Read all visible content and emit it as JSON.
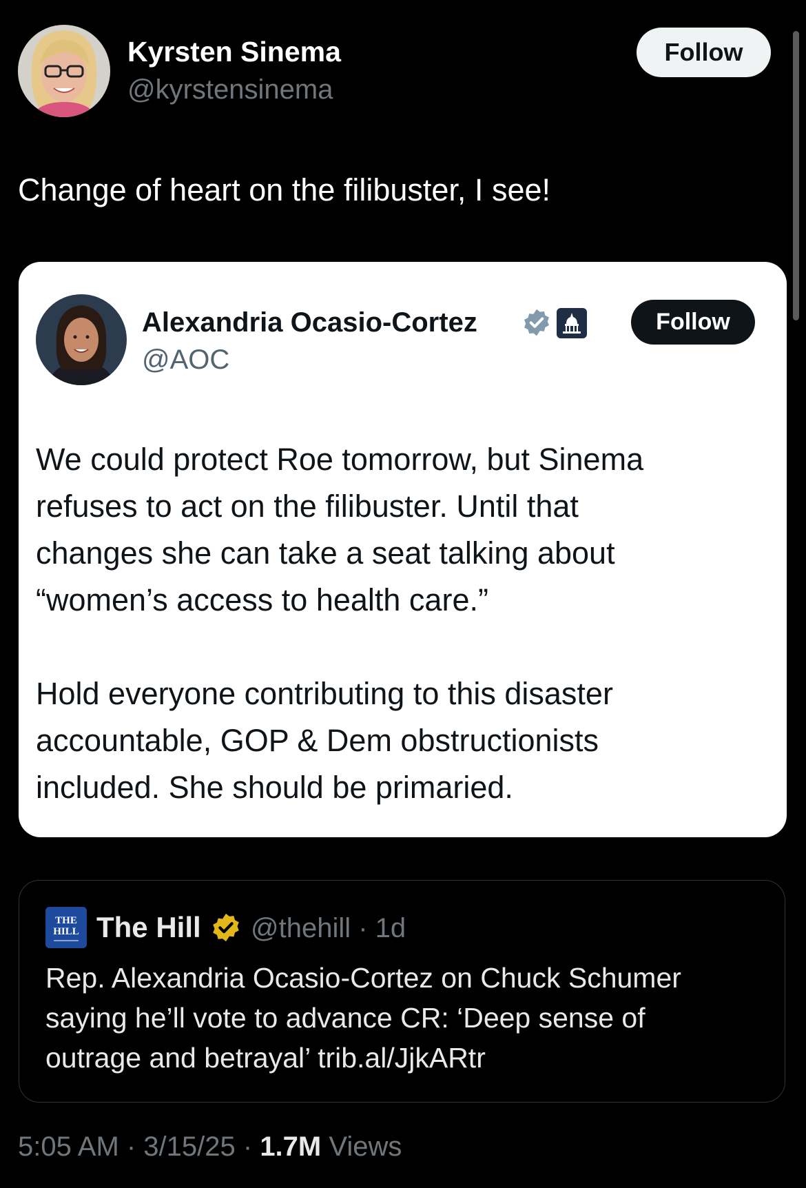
{
  "author": {
    "name": "Kyrsten Sinema",
    "handle": "@kyrstensinema",
    "follow_label": "Follow",
    "avatar_icon": "profile-photo-woman-glasses"
  },
  "tweet": {
    "text": "Change of heart on the filibuster, I see!"
  },
  "embedded_tweet": {
    "name": "Alexandria Ocasio-Cortez",
    "handle": "@AOC",
    "follow_label": "Follow",
    "verified_icon": "verified-badge-grey",
    "affiliation_icon": "capitol-building-icon",
    "paragraph1_lines": [
      "We could protect Roe tomorrow, but Sinema",
      "refuses to act on the filibuster. Until that",
      "changes she can take a seat talking about",
      "“women’s access to health care.”"
    ],
    "paragraph2_lines": [
      "Hold everyone contributing to this disaster",
      "accountable, GOP & Dem obstructionists",
      "included. She should be primaried."
    ]
  },
  "quoted_tweet": {
    "name": "The Hill",
    "handle_meta": "@thehill · 1d",
    "logo_icon": "the-hill-logo",
    "verified_icon": "verified-badge-gold",
    "lines": [
      "Rep. Alexandria Ocasio-Cortez on Chuck Schumer",
      "saying he’ll vote to advance CR: ‘Deep sense of",
      "outrage and betrayal’ trib.al/JjkARtr"
    ]
  },
  "footer": {
    "time_date": "5:05 AM · 3/15/25 · ",
    "views_count": "1.7M",
    "views_label": "Views"
  },
  "colors": {
    "background": "#000000",
    "text_primary": "#e7e9ea",
    "text_secondary": "#71767b",
    "verified_gold": "#e2b719",
    "verified_grey": "#829aab"
  }
}
